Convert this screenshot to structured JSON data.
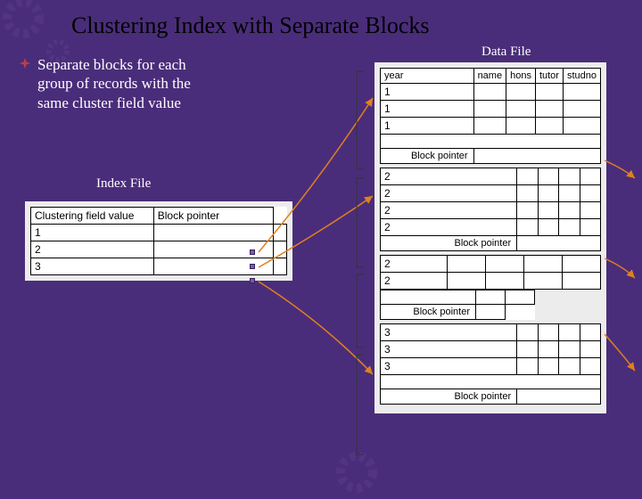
{
  "title": "Clustering Index with Separate Blocks",
  "bullet": "Separate blocks for each group of records with the same cluster field value",
  "labels": {
    "index": "Index File",
    "data": "Data File"
  },
  "index_table": {
    "headers": [
      "Clustering field value",
      "Block pointer"
    ],
    "rows": [
      "1",
      "2",
      "3"
    ]
  },
  "data_file": {
    "headers": [
      "year",
      "name",
      "hons",
      "tutor",
      "studno"
    ],
    "block_pointer": "Block pointer",
    "blocks": [
      {
        "keys": [
          "1",
          "1",
          "1"
        ],
        "has_header": true,
        "short": false
      },
      {
        "keys": [
          "2",
          "2",
          "2",
          "2"
        ],
        "has_header": false,
        "short": false
      },
      {
        "keys": [
          "2",
          "2"
        ],
        "has_header": false,
        "short": true
      },
      {
        "keys": [
          "3",
          "3",
          "3"
        ],
        "has_header": false,
        "short": false
      }
    ]
  }
}
